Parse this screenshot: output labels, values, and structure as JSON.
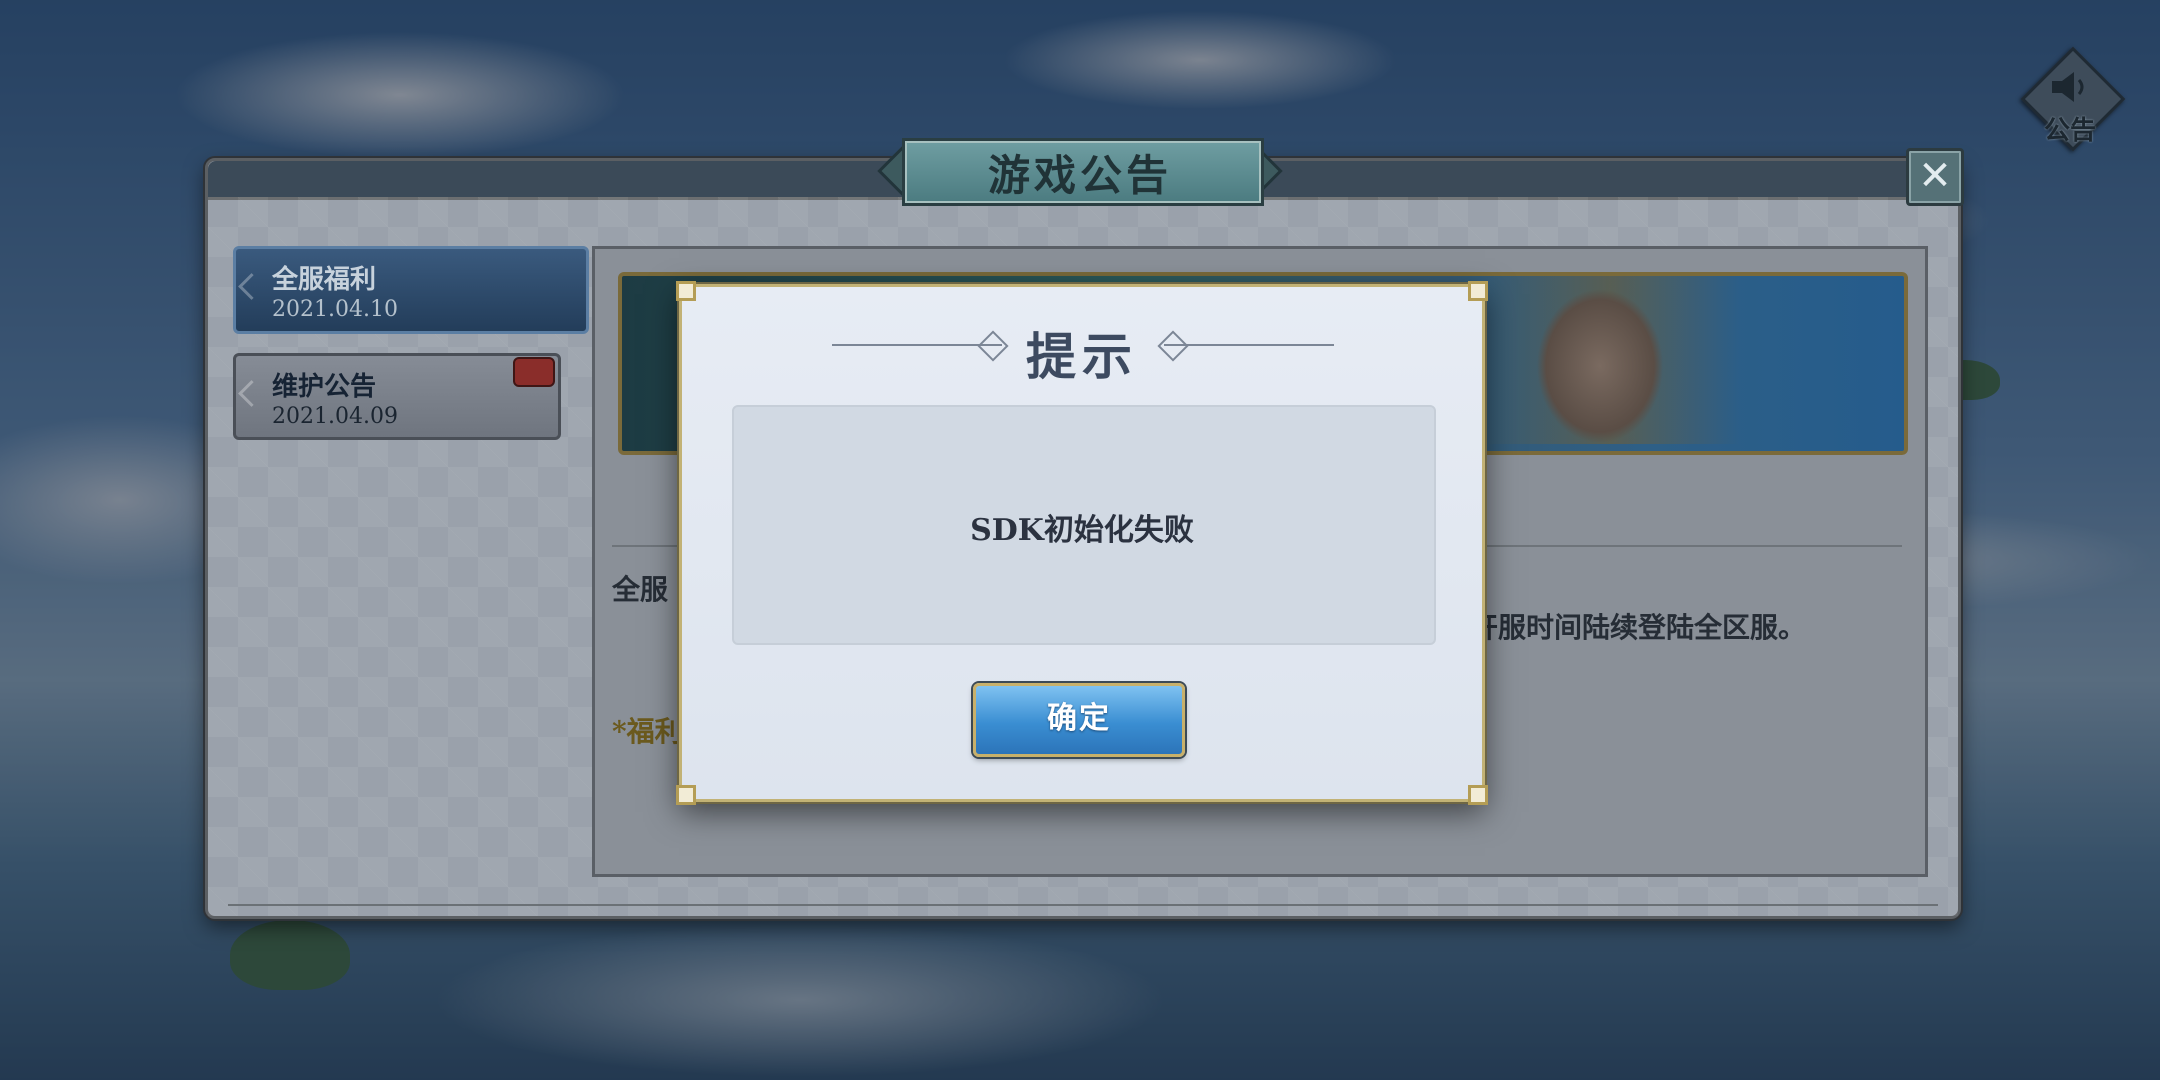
{
  "window": {
    "title": "游戏公告"
  },
  "sound_button": {
    "label": "公告",
    "icon": "speaker-icon"
  },
  "tabs": [
    {
      "title": "全服福利",
      "date": "2021.04.10",
      "active": true
    },
    {
      "title": "维护公告",
      "date": "2021.04.09",
      "active": false,
      "has_badge": true
    }
  ],
  "announcement": {
    "line1_partial": "全服",
    "line2_partial": "开服时间陆续登陆全区服。",
    "footer_partial": "*福利"
  },
  "dialog": {
    "title": "提示",
    "message": "SDK初始化失败",
    "ok_label": "确定"
  },
  "colors": {
    "accent_blue": "#3a8ed2",
    "gold_border": "#c2b275",
    "badge_red": "#8a2d2a"
  }
}
